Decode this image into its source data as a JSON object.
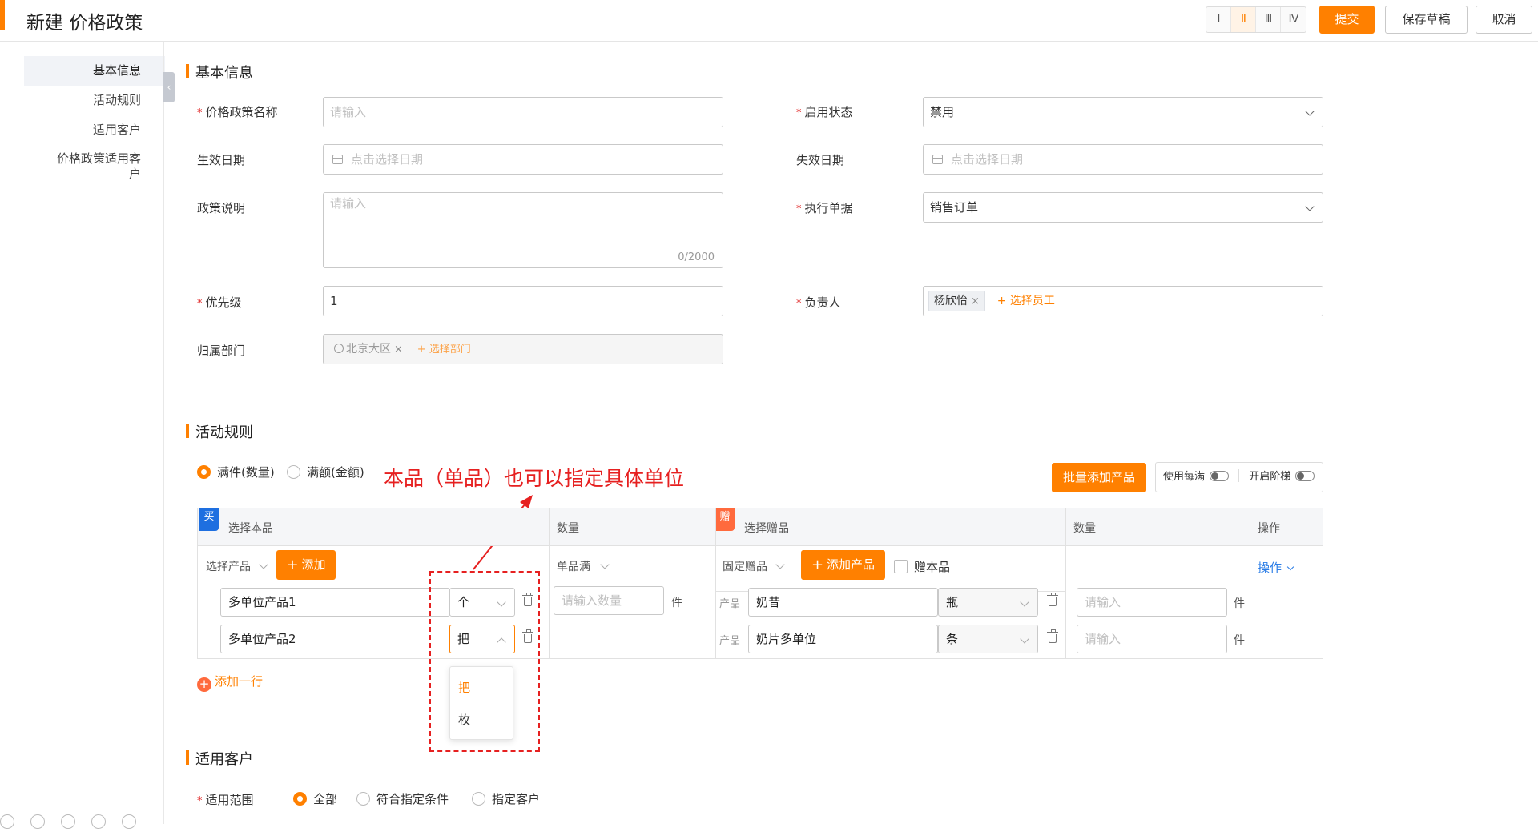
{
  "header": {
    "title": "新建 价格政策",
    "col_switch": [
      "Ⅰ",
      "Ⅱ",
      "Ⅲ",
      "Ⅳ"
    ],
    "submit_label": "提交",
    "save_draft_label": "保存草稿",
    "cancel_label": "取消"
  },
  "sidebar": {
    "items": [
      {
        "label": "基本信息"
      },
      {
        "label": "活动规则"
      },
      {
        "label": "适用客户"
      },
      {
        "label": "价格政策适用客户"
      }
    ]
  },
  "basic": {
    "title": "基本信息",
    "policy_name_label": "价格政策名称",
    "policy_name_placeholder": "请输入",
    "status_label": "启用状态",
    "status_value": "禁用",
    "effective_date_label": "生效日期",
    "effective_date_placeholder": "点击选择日期",
    "expire_date_label": "失效日期",
    "expire_date_placeholder": "点击选择日期",
    "description_label": "政策说明",
    "description_placeholder": "请输入",
    "description_counter": "0/2000",
    "doc_type_label": "执行单据",
    "doc_type_value": "销售订单",
    "priority_label": "优先级",
    "priority_value": "1",
    "owner_label": "负责人",
    "owner_tag": "杨欣怡",
    "owner_add": "+ 选择员工",
    "dept_label": "归属部门",
    "dept_tag": "北京大区",
    "dept_add": "+ 选择部门"
  },
  "rules": {
    "title": "活动规则",
    "radio_qty": "满件(数量)",
    "radio_amount": "满额(金额)",
    "batch_add_label": "批量添加产品",
    "per_full_label": "使用每满",
    "tier_label": "开启阶梯",
    "annotation": "本品（单品）也可以指定具体单位",
    "table": {
      "buy_badge": "买",
      "gift_badge": "赠",
      "col_select_product": "选择本品",
      "col_qty": "数量",
      "col_select_gift": "选择赠品",
      "col_gift_qty": "数量",
      "col_op": "操作",
      "select_product_label": "选择产品",
      "add_label": "添加",
      "single_full_label": "单品满",
      "qty_placeholder": "请输入数量",
      "unit_jian": "件",
      "fixed_gift_label": "固定赠品",
      "add_product_label": "添加产品",
      "gift_self_label": "赠本品",
      "op_label": "操作",
      "product_prefix": "产品",
      "gift_input_placeholder": "请输入",
      "buy_rows": [
        {
          "name": "多单位产品1",
          "unit": "个"
        },
        {
          "name": "多单位产品2",
          "unit": "把"
        }
      ],
      "gift_rows": [
        {
          "name": "奶昔",
          "unit": "瓶"
        },
        {
          "name": "奶片多单位",
          "unit": "条"
        }
      ]
    },
    "unit_options": [
      "把",
      "枚"
    ],
    "add_row_label": "添加一行"
  },
  "customers": {
    "title": "适用客户",
    "scope_label": "适用范围",
    "options": [
      "全部",
      "符合指定条件",
      "指定客户"
    ]
  },
  "colors": {
    "accent": "#ff8000",
    "annotation": "#e62020",
    "link_blue": "#2a7ce6"
  }
}
